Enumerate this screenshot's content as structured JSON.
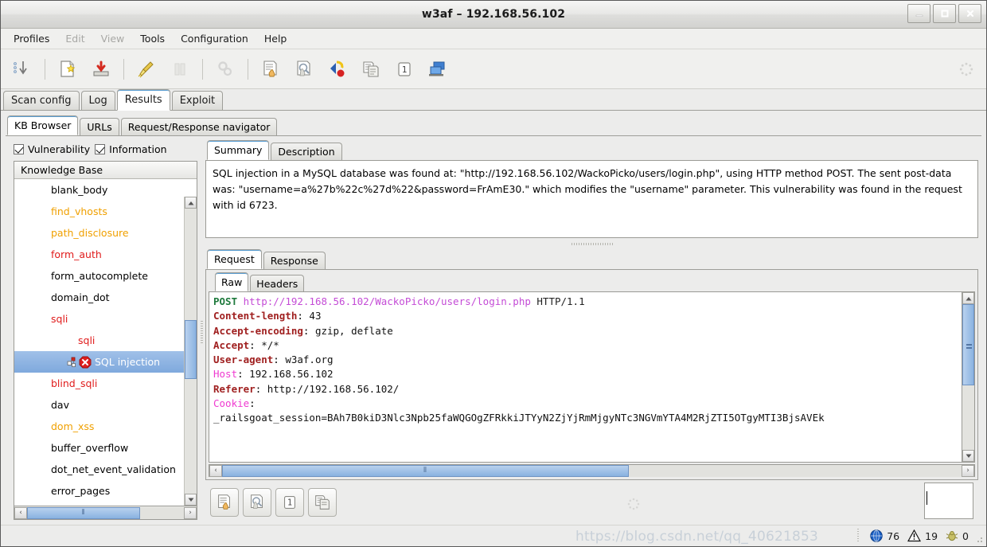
{
  "window": {
    "title": "w3af – 192.168.56.102",
    "minimize_label": "_",
    "maximize_label": "□",
    "close_label": "×"
  },
  "menu": {
    "items": [
      {
        "label": "Profiles",
        "enabled": true
      },
      {
        "label": "Edit",
        "enabled": false
      },
      {
        "label": "View",
        "enabled": false
      },
      {
        "label": "Tools",
        "enabled": true
      },
      {
        "label": "Configuration",
        "enabled": true
      },
      {
        "label": "Help",
        "enabled": true
      }
    ]
  },
  "toolbar": {
    "buttons": [
      {
        "name": "start-scan-icon",
        "title": "Start scan"
      },
      {
        "name": "new-profile-icon",
        "title": "New profile"
      },
      {
        "name": "save-profile-icon",
        "title": "Save profile"
      },
      {
        "name": "clear-icon",
        "title": "Clear"
      },
      {
        "name": "pause-icon",
        "title": "Pause",
        "disabled": true
      },
      {
        "name": "settings-gears-icon",
        "title": "Settings",
        "disabled": true
      },
      {
        "name": "manual-request-icon",
        "title": "Manual request"
      },
      {
        "name": "fuzzy-request-icon",
        "title": "Fuzzy request"
      },
      {
        "name": "proxy-icon",
        "title": "Proxy"
      },
      {
        "name": "compare-icon",
        "title": "Compare"
      },
      {
        "name": "encode-decode-icon",
        "title": "Encode / Decode"
      },
      {
        "name": "export-request-icon",
        "title": "Export request"
      }
    ]
  },
  "main_tabs": [
    {
      "label": "Scan config",
      "active": false
    },
    {
      "label": "Log",
      "active": false
    },
    {
      "label": "Results",
      "active": true
    },
    {
      "label": "Exploit",
      "active": false
    }
  ],
  "sub_tabs": [
    {
      "label": "KB Browser",
      "active": true
    },
    {
      "label": "URLs",
      "active": false
    },
    {
      "label": "Request/Response navigator",
      "active": false
    }
  ],
  "filters": [
    {
      "label": "Vulnerability",
      "checked": true
    },
    {
      "label": "Information",
      "checked": true
    }
  ],
  "knowledge_base": {
    "header": "Knowledge Base",
    "rows": [
      {
        "label": "blank_body",
        "color": "black",
        "expander": "collapsed",
        "level": 1,
        "selected": false
      },
      {
        "label": "find_vhosts",
        "color": "orange",
        "expander": "collapsed",
        "level": 1,
        "selected": false
      },
      {
        "label": "path_disclosure",
        "color": "orange",
        "expander": "collapsed",
        "level": 1,
        "selected": false
      },
      {
        "label": "form_auth",
        "color": "red",
        "expander": "collapsed",
        "level": 1,
        "selected": false
      },
      {
        "label": "form_autocomplete",
        "color": "black",
        "expander": "collapsed",
        "level": 1,
        "selected": false
      },
      {
        "label": "domain_dot",
        "color": "black",
        "expander": "collapsed",
        "level": 1,
        "selected": false
      },
      {
        "label": "sqli",
        "color": "red",
        "expander": "expanded",
        "level": 1,
        "selected": false
      },
      {
        "label": "sqli",
        "color": "red",
        "expander": "expanded",
        "level": 2,
        "selected": false
      },
      {
        "label": "SQL injection",
        "color": "white",
        "expander": "none",
        "level": 3,
        "selected": true,
        "icon": "vulnerability-error-icon"
      },
      {
        "label": "blind_sqli",
        "color": "red",
        "expander": "collapsed",
        "level": 1,
        "selected": false
      },
      {
        "label": "dav",
        "color": "black",
        "expander": "collapsed",
        "level": 1,
        "selected": false
      },
      {
        "label": "dom_xss",
        "color": "orange",
        "expander": "collapsed",
        "level": 1,
        "selected": false
      },
      {
        "label": "buffer_overflow",
        "color": "black",
        "expander": "collapsed",
        "level": 1,
        "selected": false
      },
      {
        "label": "dot_net_event_validation",
        "color": "black",
        "expander": "collapsed",
        "level": 1,
        "selected": false
      },
      {
        "label": "error_pages",
        "color": "black",
        "expander": "collapsed",
        "level": 1,
        "selected": false
      }
    ]
  },
  "detail": {
    "tabs": [
      {
        "label": "Summary",
        "active": true
      },
      {
        "label": "Description",
        "active": false
      }
    ],
    "summary_text": "SQL injection in a MySQL database was found at: \"http://192.168.56.102/WackoPicko/users/login.php\", using HTTP method POST. The sent post-data was: \"username=a%27b%22c%27d%22&password=FrAmE30.\" which modifies the \"username\" parameter. This vulnerability was found in the request with id 6723."
  },
  "request_response": {
    "tabs": [
      {
        "label": "Request",
        "active": true
      },
      {
        "label": "Response",
        "active": false
      }
    ],
    "view_tabs": [
      {
        "label": "Raw",
        "active": true
      },
      {
        "label": "Headers",
        "active": false
      }
    ],
    "raw_request": {
      "method": "POST",
      "url": "http://192.168.56.102/WackoPicko/users/login.php",
      "protocol": "HTTP/1.1",
      "headers": [
        {
          "name": "Content-length",
          "value": "43",
          "style": "hdr"
        },
        {
          "name": "Accept-encoding",
          "value": "gzip, deflate",
          "style": "hdr"
        },
        {
          "name": "Accept",
          "value": "*/*",
          "style": "hdr"
        },
        {
          "name": "User-agent",
          "value": "w3af.org",
          "style": "hdr"
        },
        {
          "name": "Host",
          "value": "192.168.56.102",
          "style": "hdr-alt"
        },
        {
          "name": "Referer",
          "value": "http://192.168.56.102/",
          "style": "hdr"
        },
        {
          "name": "Cookie",
          "value": "",
          "style": "hdr-alt"
        }
      ],
      "cookie_value": "_railsgoat_session=BAh7B0kiD3Nlc3Npb25faWQGOgZFRkkiJTYyN2ZjYjRmMjgyNTc3NGVmYTA4M2RjZTI5OTgyMTI3BjsAVEk"
    }
  },
  "bottom_buttons": [
    {
      "name": "manual-request-icon",
      "title": "Send to manual request"
    },
    {
      "name": "fuzzy-request-icon",
      "title": "Send to fuzzy request"
    },
    {
      "name": "encode-decode-icon",
      "title": "Encode / Decode"
    },
    {
      "name": "export-request-icon",
      "title": "Export request"
    }
  ],
  "status_bar": {
    "info_count": "76",
    "warning_count": "19",
    "bug_count": "0",
    "watermark": "https://blog.csdn.net/qq_40621853"
  },
  "colors": {
    "accent_blue": "#7fa9dd",
    "orange": "#f0a000",
    "red": "#e01b1b",
    "method_green": "#1f7a3d",
    "url_magenta": "#c44bd6",
    "header_darkred": "#a02020",
    "header_pink": "#ef3ad0"
  }
}
